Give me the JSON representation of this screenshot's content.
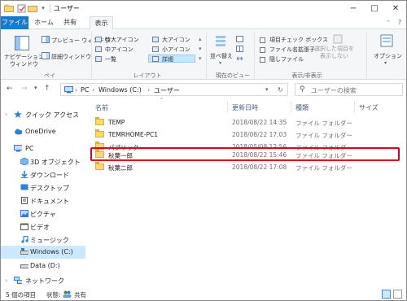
{
  "title_bar": {
    "title": "ユーザー"
  },
  "ribbon_tabs": [
    "ファイル",
    "ホーム",
    "共有",
    "表示"
  ],
  "ribbon": {
    "nav_pane_label": "ナビゲーション\nウィンドウ",
    "preview_pane": "プレビュー ウィンドウ",
    "details_pane": "詳細ウィンドウ",
    "pane_group": "ペイン",
    "layout_items": [
      "特大アイコン",
      "大アイコン",
      "中アイコン",
      "小アイコン",
      "一覧",
      "詳細"
    ],
    "layout_group": "レイアウト",
    "sort_label": "並べ替え",
    "current_view_group": "現在のビュー",
    "item_checkboxes": "項目チェック ボックス",
    "file_extensions": "ファイル名拡張子",
    "hidden_files": "隠しファイル",
    "hide_selected": "選択した項目を\n表示しない",
    "show_hide_group": "表示/非表示",
    "options_label": "オプション"
  },
  "address_bar": {
    "breadcrumb": [
      "PC",
      "Windows (C:)",
      "ユーザー"
    ],
    "search_placeholder": "ユーザーの検索"
  },
  "nav_pane": [
    {
      "label": "クイック アクセス",
      "icon": "star-icon"
    },
    {
      "label": "OneDrive",
      "icon": "cloud-icon"
    },
    {
      "label": "PC",
      "icon": "computer-icon"
    },
    {
      "label": "3D オブジェクト",
      "icon": "cube-icon"
    },
    {
      "label": "ダウンロード",
      "icon": "download-icon"
    },
    {
      "label": "デスクトップ",
      "icon": "desktop-icon"
    },
    {
      "label": "ドキュメント",
      "icon": "document-icon"
    },
    {
      "label": "ピクチャ",
      "icon": "picture-icon"
    },
    {
      "label": "ビデオ",
      "icon": "video-icon"
    },
    {
      "label": "ミュージック",
      "icon": "music-icon"
    },
    {
      "label": "Windows (C:)",
      "icon": "drive-icon"
    },
    {
      "label": "Data (D:)",
      "icon": "drive-icon"
    },
    {
      "label": "ネットワーク",
      "icon": "network-icon"
    }
  ],
  "columns": [
    "名前",
    "更新日時",
    "種類",
    "サイズ"
  ],
  "files": [
    {
      "name": "TEMP",
      "date": "2018/08/22 14:35",
      "type": "ファイル フォルダー"
    },
    {
      "name": "TEMRHOME-PC1",
      "date": "2018/08/22 17:03",
      "type": "ファイル フォルダー"
    },
    {
      "name": "パブリック",
      "date": "2018/05/08 12:56",
      "type": "ファイル フォルダー"
    },
    {
      "name": "秋葉一郎",
      "date": "2018/08/22 15:46",
      "type": "ファイル フォルダー"
    },
    {
      "name": "秋葉二郎",
      "date": "2018/08/22 17:08",
      "type": "ファイル フォルダー"
    }
  ],
  "status_bar": {
    "item_count": "5 個の項目",
    "state_label": "状態:",
    "shared": "共有"
  },
  "colors": {
    "file_tab": "#1979ca",
    "highlight": "#e0001b",
    "selected_nav": "#cce8ff",
    "folder": "#f8d775"
  }
}
